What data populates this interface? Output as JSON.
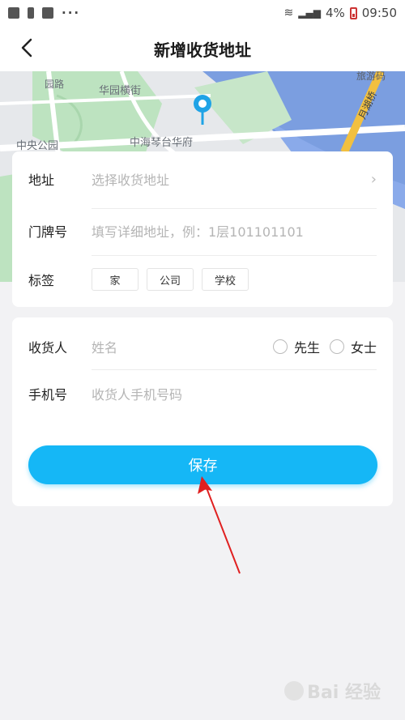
{
  "status_bar": {
    "battery": "4%",
    "time": "09:50"
  },
  "nav": {
    "title": "新增收货地址"
  },
  "map": {
    "labels": [
      "园路",
      "华园横街",
      "中央公园",
      "中海琴台华府",
      "旅游码",
      "月湖桥"
    ],
    "pin_color": "#1fa3e6"
  },
  "address_card": {
    "address_label": "地址",
    "address_placeholder": "选择收货地址",
    "house_label": "门牌号",
    "house_placeholder": "填写详细地址，例：1层101101101",
    "tag_label": "标签",
    "tags": [
      "家",
      "公司",
      "学校"
    ]
  },
  "contact_card": {
    "receiver_label": "收货人",
    "receiver_placeholder": "姓名",
    "gender_options": [
      "先生",
      "女士"
    ],
    "phone_label": "手机号",
    "phone_placeholder": "收货人手机号码"
  },
  "save_button": "保存",
  "colors": {
    "accent": "#15b7f6",
    "annotation_arrow": "#e02020"
  },
  "watermark": "Bai 经验"
}
